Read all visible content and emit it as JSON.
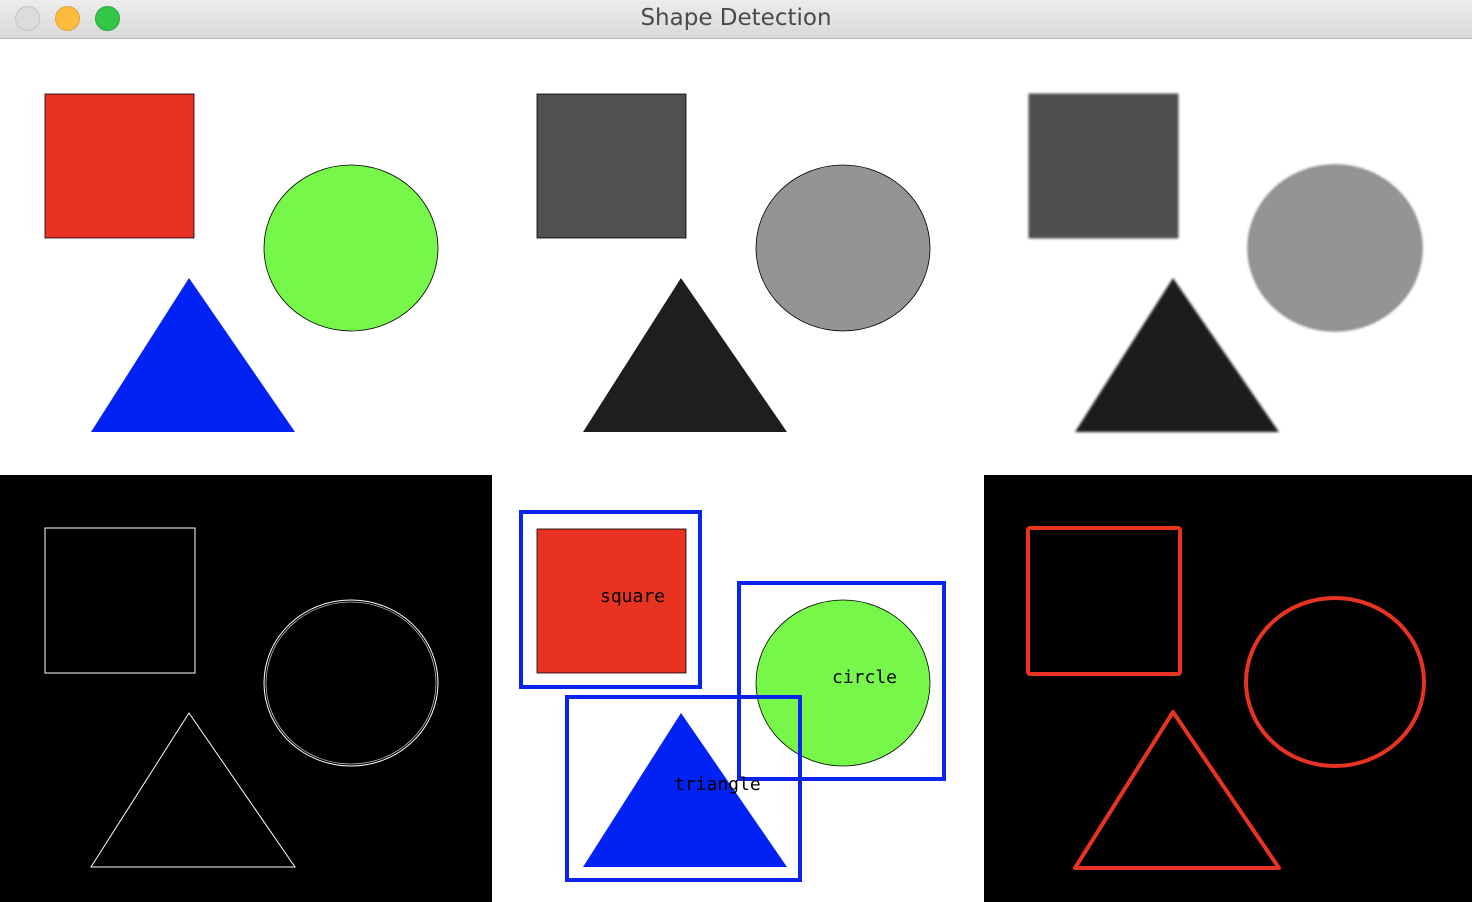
{
  "window": {
    "title": "Shape Detection",
    "buttons": [
      "close-button",
      "minimize-button",
      "zoom-button"
    ]
  },
  "panels": [
    {
      "id": "original",
      "background": "#ffffff",
      "shape_colors": {
        "square": "#e83323",
        "circle": "#76f74a",
        "triangle": "#0022f5"
      }
    },
    {
      "id": "grayscale",
      "background": "#ffffff",
      "shape_colors": {
        "square": "#505050",
        "circle": "#949494",
        "triangle": "#1e1e1e"
      }
    },
    {
      "id": "blurred",
      "background": "#ffffff",
      "shape_colors": {
        "square": "#505050",
        "circle": "#949494",
        "triangle": "#1e1e1e"
      }
    },
    {
      "id": "edges",
      "background": "#000000",
      "stroke": "#ffffff"
    },
    {
      "id": "detected",
      "background": "#ffffff",
      "box_color": "#0a24f0",
      "label_color": "#000000",
      "labels": {
        "square": "square",
        "circle": "circle",
        "triangle": "triangle"
      }
    },
    {
      "id": "contours",
      "background": "#000000",
      "stroke": "#e83323"
    }
  ]
}
